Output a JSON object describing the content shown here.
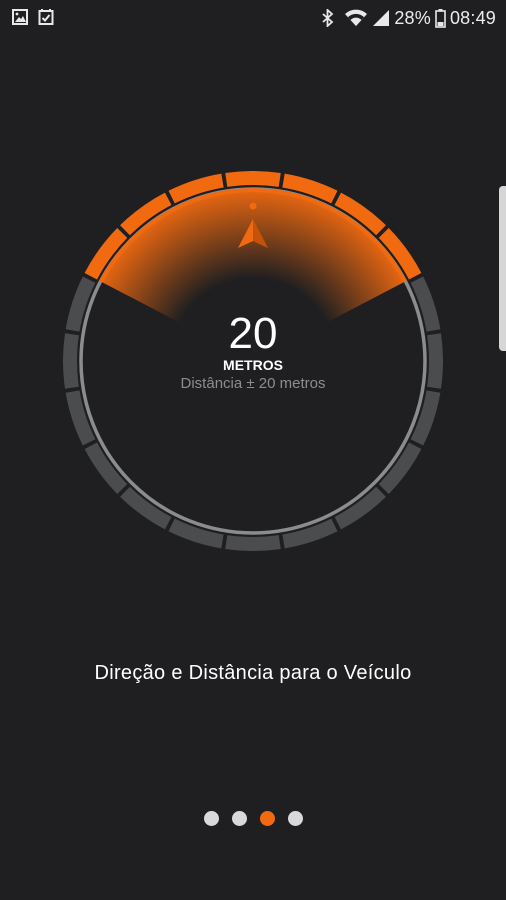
{
  "status_bar": {
    "battery_percent": "28%",
    "time": "08:49",
    "left_icons": [
      "image-icon",
      "calendar-check-icon"
    ],
    "right_icons": [
      "bluetooth-icon",
      "wifi-icon",
      "signal-icon",
      "battery-icon"
    ]
  },
  "dial": {
    "value": "20",
    "unit": "METROS",
    "accuracy": "Distância ± 20 metros",
    "colors": {
      "accent": "#f26a10",
      "ring": "#4a4c4d",
      "background": "#1f1f21"
    }
  },
  "caption": "Direção e Distância para o Veículo",
  "pager": {
    "count": 4,
    "active_index": 2
  }
}
